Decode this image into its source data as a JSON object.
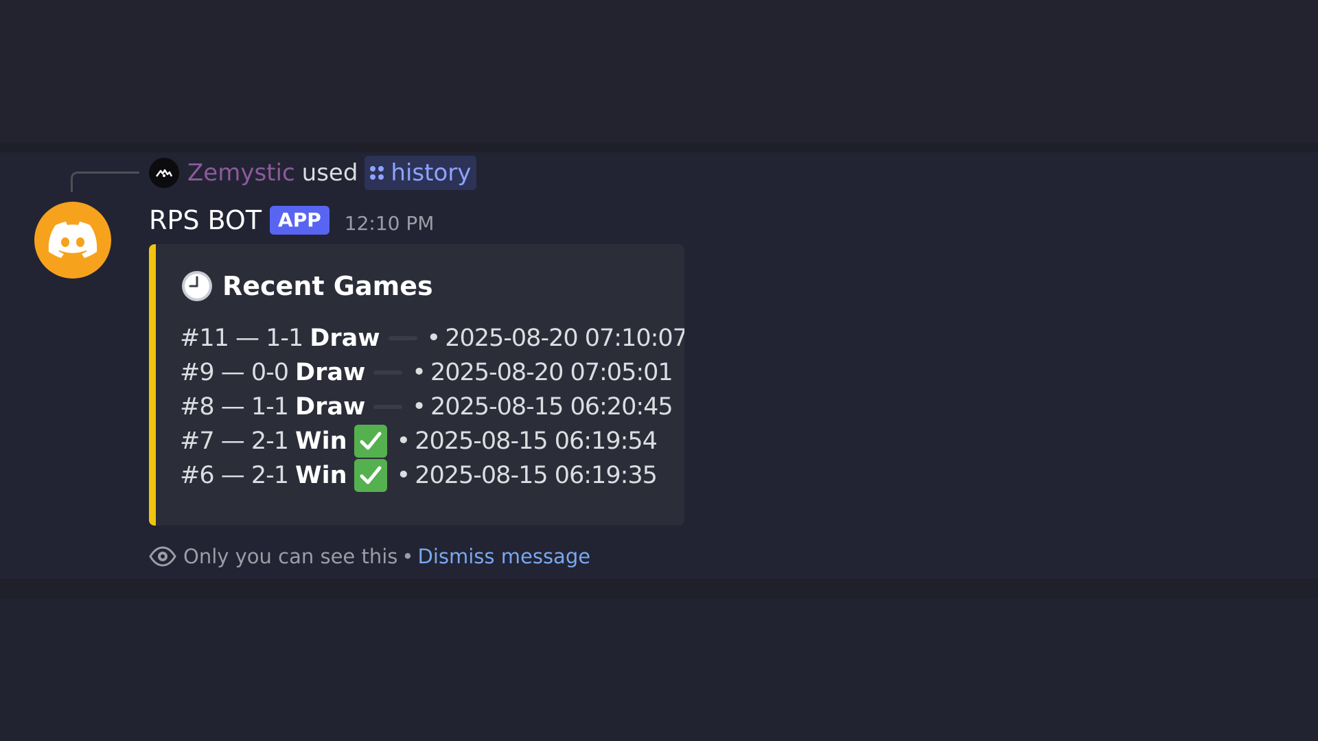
{
  "interaction": {
    "user_name": "Zemystic",
    "used_text": "used",
    "command_name": "history",
    "command_icon": "app-command-icon"
  },
  "message": {
    "author": "RPS BOT",
    "badge": "APP",
    "timestamp": "12:10 PM",
    "avatar_icon": "discord-logo-icon",
    "avatar_color": "#f6a21d"
  },
  "embed": {
    "accent_color": "#f1c40f",
    "title_icon": "clock-icon",
    "title": "Recent Games",
    "games": [
      {
        "prefix": "#11 — 1-1",
        "result": "Draw",
        "mark": "draw",
        "date": "2025-08-20 07:10:07"
      },
      {
        "prefix": "#9 — 0-0",
        "result": "Draw",
        "mark": "draw",
        "date": "2025-08-20 07:05:01"
      },
      {
        "prefix": "#8 — 1-1",
        "result": "Draw",
        "mark": "draw",
        "date": "2025-08-15 06:20:45"
      },
      {
        "prefix": "#7 — 2-1",
        "result": "Win",
        "mark": "check",
        "date": "2025-08-15 06:19:54"
      },
      {
        "prefix": "#6 — 2-1",
        "result": "Win",
        "mark": "check",
        "date": "2025-08-15 06:19:35"
      }
    ],
    "bullet": "•"
  },
  "footer": {
    "notice": "Only you can see this",
    "separator": "•",
    "dismiss": "Dismiss message"
  }
}
